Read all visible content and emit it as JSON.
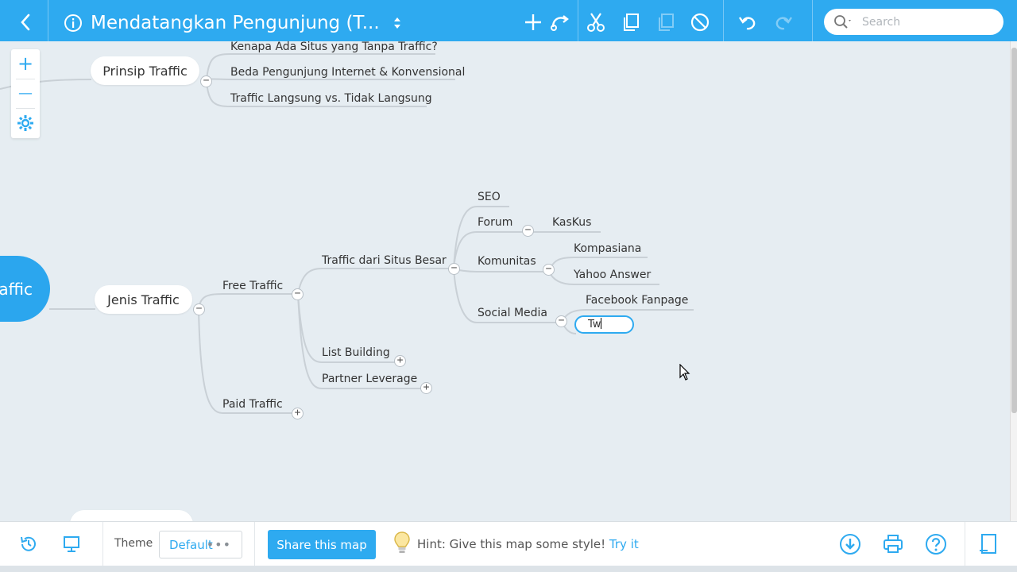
{
  "header": {
    "back_icon": "chevron-left-icon",
    "info_icon": "info-icon",
    "title": "Mendatangkan Pengunjung (T...",
    "sort_icon": "sort-updown-icon",
    "tools": [
      "add-icon",
      "connect-icon",
      "cut-icon",
      "copy-icon",
      "paste-icon",
      "delete-icon",
      "undo-icon",
      "redo-icon"
    ],
    "search": {
      "placeholder": "Search"
    }
  },
  "zoom": {
    "in_label": "+",
    "out_label": "—",
    "settings_icon": "gear-icon"
  },
  "map": {
    "central": {
      "label": "affic"
    },
    "prinsip": {
      "label": "Prinsip Traffic",
      "children": [
        "Kenapa Ada Situs yang Tanpa Traffic?",
        "Beda Pengunjung Internet & Konvensional",
        "Traffic Langsung vs. Tidak Langsung"
      ]
    },
    "jenis": {
      "label": "Jenis Traffic",
      "free": {
        "label": "Free Traffic",
        "situs_besar": {
          "label": "Traffic dari Situs Besar",
          "seo": "SEO",
          "forum": {
            "label": "Forum",
            "children": [
              "KasKus"
            ]
          },
          "komunitas": {
            "label": "Komunitas",
            "children": [
              "Kompasiana",
              "Yahoo Answer"
            ]
          },
          "social": {
            "label": "Social Media",
            "children": [
              "Facebook Fanpage"
            ],
            "editing_value": "Tw"
          }
        },
        "list_building": "List Building",
        "partner": "Partner Leverage"
      },
      "paid": "Paid Traffic"
    },
    "toggle_collapse": "−",
    "toggle_expand": "+"
  },
  "footer": {
    "history_icon": "history-icon",
    "present_icon": "presentation-icon",
    "theme_label": "Theme",
    "theme_value": "Default",
    "theme_more": "•••",
    "share_label": "Share this map",
    "hint_icon": "lightbulb-icon",
    "hint_text": "Hint: Give this map some style!",
    "hint_link": "Try it",
    "download_icon": "download-icon",
    "print_icon": "print-icon",
    "help_icon": "help-icon",
    "panel_icon": "panel-icon"
  },
  "colors": {
    "accent": "#2eaaf0",
    "canvas": "#e6edf2",
    "line": "#c9d0d6"
  }
}
